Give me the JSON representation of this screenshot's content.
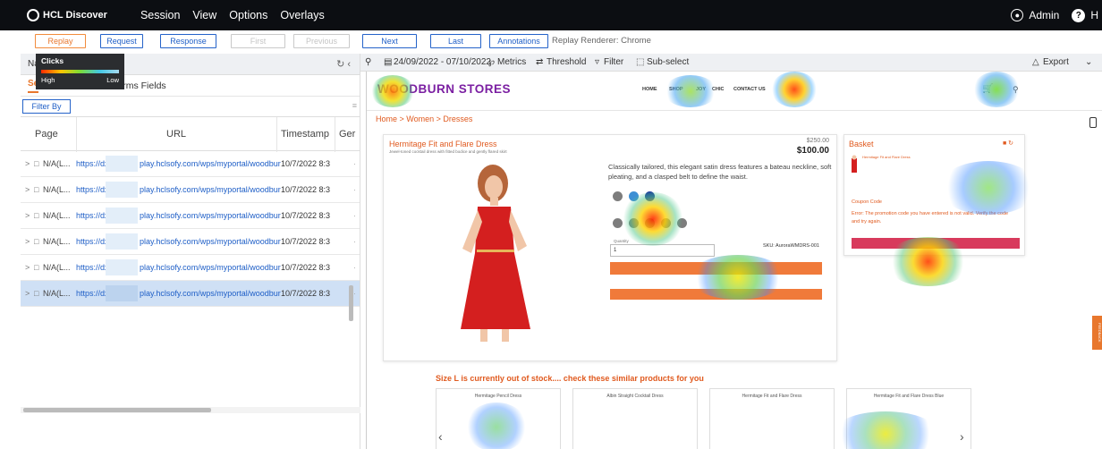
{
  "app": {
    "name": "HCL Discover",
    "menu": [
      "Session",
      "View",
      "Options",
      "Overlays"
    ],
    "user": "Admin",
    "help_label": "H"
  },
  "toolbar": {
    "replay": "Replay",
    "request": "Request",
    "response": "Response",
    "first": "First",
    "previous": "Previous",
    "next": "Next",
    "last": "Last",
    "annotations": "Annotations",
    "renderer": "Replay Renderer: Chrome"
  },
  "legend": {
    "title": "Clicks",
    "high": "High",
    "low": "Low"
  },
  "left_panel": {
    "header_label": "Na",
    "tab_search": "Se",
    "tab_forms": "rms Fields",
    "filter_button": "Filter By",
    "columns": [
      "Page",
      "URL",
      "Timestamp",
      "Ger"
    ],
    "rows": [
      {
        "page": "N/A(L...",
        "url_start": "https://dx",
        "url_end": "play.hclsofy.com/wps/myportal/woodbur",
        "timestamp": "10/7/2022 8:3"
      },
      {
        "page": "N/A(L...",
        "url_start": "https://dx",
        "url_end": "play.hclsofy.com/wps/myportal/woodbur",
        "timestamp": "10/7/2022 8:3"
      },
      {
        "page": "N/A(L...",
        "url_start": "https://dx",
        "url_end": "play.hclsofy.com/wps/myportal/woodbur",
        "timestamp": "10/7/2022 8:3"
      },
      {
        "page": "N/A(L...",
        "url_start": "https://dx",
        "url_end": "play.hclsofy.com/wps/myportal/woodbur",
        "timestamp": "10/7/2022 8:3"
      },
      {
        "page": "N/A(L...",
        "url_start": "https://dx",
        "url_end": "play.hclsofy.com/wps/myportal/woodbur",
        "timestamp": "10/7/2022 8:3"
      },
      {
        "page": "N/A(L...",
        "url_start": "https://dx",
        "url_end": "play.hclsofy.com/wps/myportal/woodbur",
        "timestamp": "10/7/2022 8:3"
      }
    ],
    "selected_row": 5
  },
  "replay_bar": {
    "date_range": "24/09/2022 - 07/10/2022",
    "metrics": "Metrics",
    "threshold": "Threshold",
    "filter": "Filter",
    "subselect": "Sub-select",
    "export": "Export"
  },
  "site": {
    "logo": "WOODBURN STORES",
    "nav": [
      "HOME",
      "SHOP",
      "JOY",
      "CHIC",
      "CONTACT US"
    ],
    "breadcrumb": "Home > Women > Dresses",
    "product_title": "Hermitage Fit and Flare Dress",
    "product_subtitle": "Jewel-toned cocktail dress with fitted bodice and gently flared skirt",
    "price_old": "$250.00",
    "price": "$100.00",
    "description": "Classically tailored, this elegant satin dress features a bateau neckline, soft pleating, and a clasped belt to define the waist.",
    "quantity_label": "Quantity",
    "quantity_value": "1",
    "sku": "SKU: AuroraWMDRS-001",
    "basket_title": "Basket",
    "basket_item": "Hermitage Fit and Flare Dress",
    "coupon_label": "Coupon Code",
    "coupon_error": "Error: The promotion code you have entered is not valid. Verify the code and try again.",
    "similar_title": "Size L is currently out of stock.... check these similar products for you",
    "similar_products": [
      "Hermitage Pencil Dress",
      "Albin Straight Cocktail Dress",
      "Hermitage Fit and Flare Dress",
      "Hermitage Fit and Flare Dress Blue"
    ],
    "feedback": "FEEDBACK"
  },
  "colors": {
    "topbar": "#0c0e12",
    "accent_orange": "#e8772d",
    "link_blue": "#1f5fc7",
    "selected_row": "#cfe0f5",
    "dress_red": "#d41f1f"
  }
}
